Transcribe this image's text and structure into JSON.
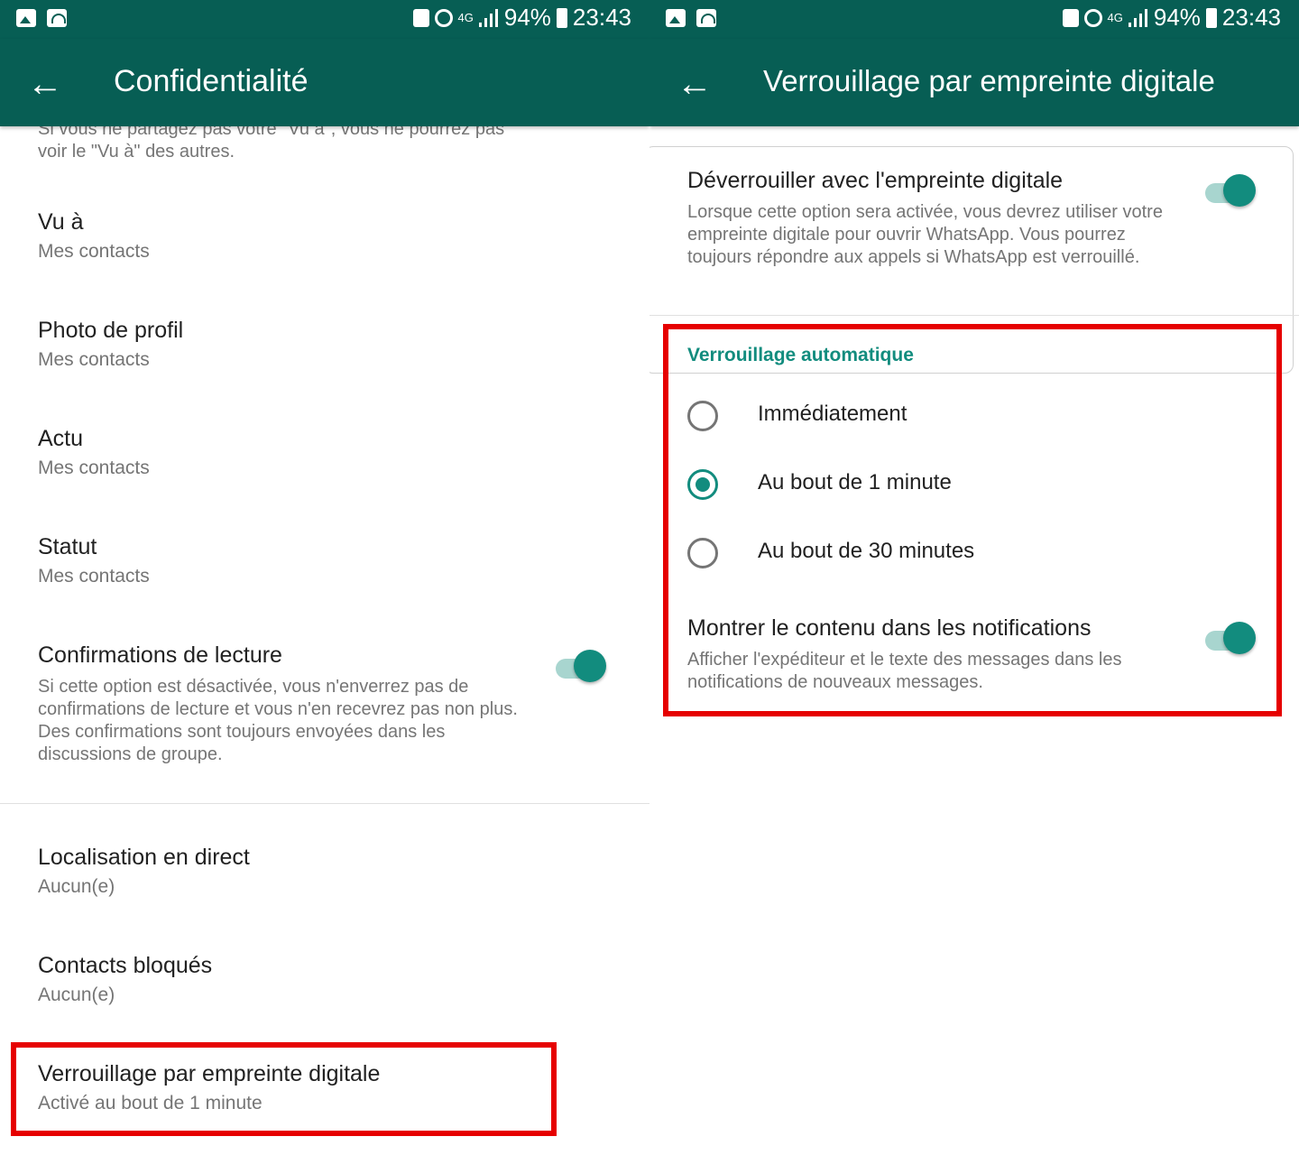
{
  "status_bar": {
    "battery": "94%",
    "time": "23:43",
    "network": "4G",
    "icons": [
      "gallery-icon",
      "wifi-icon",
      "battery-saver-icon",
      "alarm-icon",
      "signal-icon",
      "battery-icon"
    ]
  },
  "left": {
    "title": "Confidentialité",
    "truncated_text_line1": "Si vous ne partagez pas votre \"Vu à\", vous ne pourrez pas",
    "truncated_text_line2": "voir le \"Vu à\" des autres.",
    "items": [
      {
        "title": "Vu à",
        "subtitle": "Mes contacts"
      },
      {
        "title": "Photo de profil",
        "subtitle": "Mes contacts"
      },
      {
        "title": "Actu",
        "subtitle": "Mes contacts"
      },
      {
        "title": "Statut",
        "subtitle": "Mes contacts"
      }
    ],
    "read_receipts": {
      "title": "Confirmations de lecture",
      "description": "Si cette option est désactivée, vous n'enverrez pas de confirmations de lecture et vous n'en recevrez pas non plus. Des confirmations sont toujours envoyées dans les discussions de groupe.",
      "enabled": true
    },
    "items2": [
      {
        "title": "Localisation en direct",
        "subtitle": "Aucun(e)"
      },
      {
        "title": "Contacts bloqués",
        "subtitle": "Aucun(e)"
      },
      {
        "title": "Verrouillage par empreinte digitale",
        "subtitle": "Activé au bout de 1 minute"
      }
    ]
  },
  "right": {
    "title": "Verrouillage par empreinte digitale",
    "unlock": {
      "title": "Déverrouiller avec l'empreinte digitale",
      "description": "Lorsque cette option sera activée, vous devrez utiliser votre empreinte digitale pour ouvrir WhatsApp. Vous pourrez toujours répondre aux appels si WhatsApp est verrouillé.",
      "enabled": true
    },
    "auto_lock_header": "Verrouillage automatique",
    "options": [
      {
        "label": "Immédiatement",
        "checked": false
      },
      {
        "label": "Au bout de 1 minute",
        "checked": true
      },
      {
        "label": "Au bout de 30 minutes",
        "checked": false
      }
    ],
    "notifications": {
      "title": "Montrer le contenu dans les notifications",
      "description": "Afficher l'expéditeur et le texte des messages dans les notifications de nouveaux messages.",
      "enabled": true
    }
  },
  "colors": {
    "primary": "#075e54",
    "accent": "#128c7e",
    "highlight": "#e60000"
  }
}
